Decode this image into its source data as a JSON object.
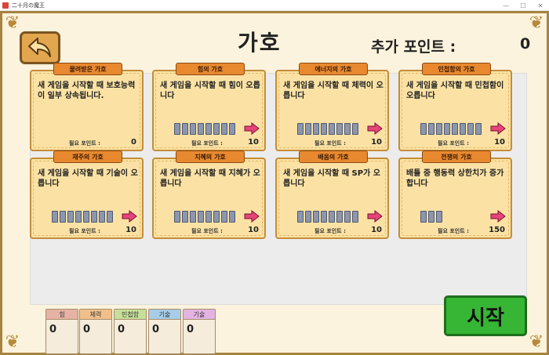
{
  "window": {
    "title": "二十月の魔王",
    "controls": [
      "—",
      "☐",
      "✕"
    ]
  },
  "header": {
    "title": "가호",
    "points_label": "추가 포인트 :",
    "points_value": "0"
  },
  "cards": [
    {
      "title": "물려받은 가호",
      "desc": "새 게임을 시작할 때 보호능력이 일부 상속됩니다.",
      "blocks": 0,
      "arrow": false,
      "cost_label": "필요 포인트 :",
      "cost": "0"
    },
    {
      "title": "힘의 가호",
      "desc": "새 게임을 시작할 때 힘이 오릅니다",
      "blocks": 8,
      "arrow": true,
      "cost_label": "필요 포인트 :",
      "cost": "10"
    },
    {
      "title": "에너지의 가호",
      "desc": "새 게임을 시작할 때 체력이 오릅니다",
      "blocks": 8,
      "arrow": true,
      "cost_label": "필요 포인트 :",
      "cost": "10"
    },
    {
      "title": "민첩함의 가호",
      "desc": "새 게임을 시작할 때 민첩함이 오릅니다",
      "blocks": 8,
      "arrow": true,
      "cost_label": "필요 포인트 :",
      "cost": "10"
    },
    {
      "title": "재주의 가호",
      "desc": "새 게임을 시작할 때 기술이 오릅니다",
      "blocks": 8,
      "arrow": true,
      "cost_label": "필요 포인트 :",
      "cost": "10"
    },
    {
      "title": "지혜의 가호",
      "desc": "새 게임을 시작할 때 지혜가 오릅니다",
      "blocks": 8,
      "arrow": true,
      "cost_label": "필요 포인트 :",
      "cost": "10"
    },
    {
      "title": "배움의 가호",
      "desc": "새 게임을 시작할 때 SP가 오릅니다",
      "blocks": 8,
      "arrow": true,
      "cost_label": "필요 포인트 :",
      "cost": "10"
    },
    {
      "title": "전쟁의 가호",
      "desc": "배틀 중 행동력 상한치가 증가합니다",
      "blocks": 3,
      "arrow": true,
      "cost_label": "필요 포인트 :",
      "cost": "150"
    }
  ],
  "stats": [
    {
      "label": "힘",
      "value": "0",
      "color": "#e7b2a6"
    },
    {
      "label": "체력",
      "value": "0",
      "color": "#f1c08a"
    },
    {
      "label": "민첩함",
      "value": "0",
      "color": "#c7df9a"
    },
    {
      "label": "기술",
      "value": "0",
      "color": "#a7cde8"
    },
    {
      "label": "기술",
      "value": "0",
      "color": "#e3b3e2"
    }
  ],
  "start_label": "시작",
  "icons": {
    "back": "back-arrow-icon",
    "increase": "right-arrow-icon"
  },
  "colors": {
    "frame": "#a6833f",
    "card": "#fbe2a4",
    "card_title": "#e8892f",
    "start": "#37b534",
    "arrow": "#e5457a"
  }
}
